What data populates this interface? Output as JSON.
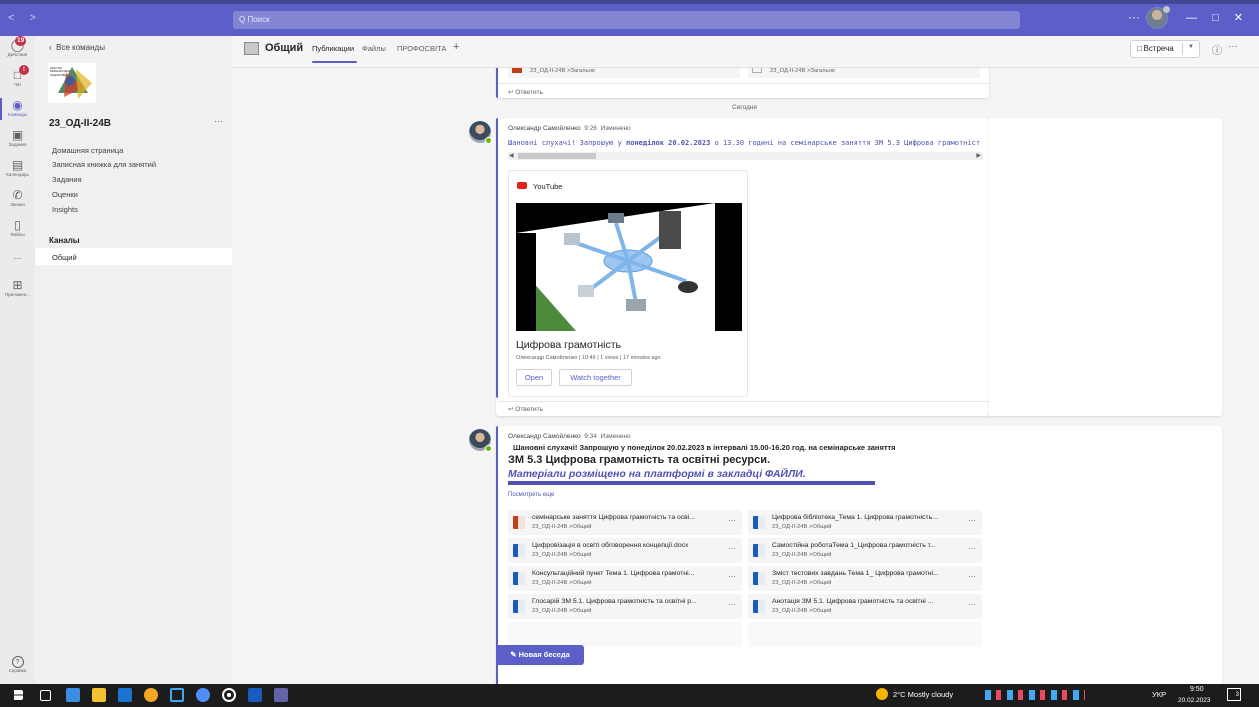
{
  "titlebar": {
    "nav": "< >",
    "search_placeholder": "Q Поиск",
    "more": "···",
    "window_controls": "— □ ✕"
  },
  "rail": {
    "items": [
      {
        "label": "Действия",
        "icon": "bell-icon",
        "glyph": "🔔",
        "badge": "19"
      },
      {
        "label": "Чат",
        "icon": "chat-icon",
        "glyph": "💬",
        "badge": "!"
      },
      {
        "label": "Команды",
        "icon": "teams-icon",
        "glyph": "👥",
        "active": true
      },
      {
        "label": "Задания",
        "icon": "assignments-icon",
        "glyph": "🎒"
      },
      {
        "label": "Календарь",
        "icon": "calendar-icon",
        "glyph": "📅"
      },
      {
        "label": "Звонки",
        "icon": "phone-icon",
        "glyph": "✆"
      },
      {
        "label": "Файлы",
        "icon": "file-icon",
        "glyph": "🗋"
      },
      {
        "label": "...",
        "icon": "more-icon",
        "glyph": ""
      },
      {
        "label": "Приложен...",
        "icon": "apps-icon",
        "glyph": "⊞"
      }
    ],
    "help_label": "Справка",
    "help_glyph": "?"
  },
  "left": {
    "back_label": "Все команды",
    "logo_text": "2023 XIII МІЖНАРОДНА ІНІЦІАТИВА",
    "team_name": "23_ОД-ІІ-24В",
    "more": "···",
    "links": [
      "Домашняя страница",
      "Записная книжка для занятий",
      "Задания",
      "Оценки",
      "Insights"
    ],
    "channels_header": "Каналы",
    "channel": "Общий"
  },
  "header": {
    "channel_title": "Общий",
    "tabs": [
      "Публикации",
      "Файлы",
      "ПРОФОСВІТА"
    ],
    "add_tab": "+",
    "meet_label": "Встреча",
    "meet_icon": "video-icon",
    "info": "ⓘ",
    "more": "···"
  },
  "conv": {
    "top_files": [
      {
        "path": "23_ОД-ІІ-24В >Загальне"
      },
      {
        "path": "23_ОД-ІІ-24В >Загальне"
      }
    ],
    "reply_label": "Ответить",
    "date_sep": "Сегодня",
    "msg1": {
      "author": "Олександр Самойленко",
      "time": "9:26",
      "edited": "Изменено",
      "text_plain": "Шановні слухачі! Запрошую у ",
      "text_bold": "понеділок 20.02.2023",
      "text_rest": " о 13.30 годині на семінарське заняття ЗМ 5.3 Цифрова грамотніст",
      "yt_label": "YouTube",
      "video_title": "Цифрова грамотність",
      "video_meta": "Олександр Самойленко | 10:46 | 1 views | 17 minutes ago",
      "btn_open": "Open",
      "btn_watch": "Watch together"
    },
    "msg2": {
      "author": "Олександр Самойленко",
      "time": "9:34",
      "edited": "Изменено",
      "line1": "Шановні слухачі! Запрошую у понеділок 20.02.2023 в інтервалі 15.00-16.20 год. на семінарське заняття",
      "line2": "ЗМ 5.3 Цифрова грамотність та освітні ресурси.",
      "line3": "Матеріали розміщено на платформі в закладці ФАЙЛИ.",
      "see_more": "Посмотреть еще",
      "files": [
        {
          "name": "семінарське заняття Цифрова грамотність та осві...",
          "path": "23_ОД-ІІ-24В >Общий",
          "type": "ppt"
        },
        {
          "name": "Цифрова бібліотека_Тема 1. Цифрова грамотність...",
          "path": "23_ОД-ІІ-24В >Общий",
          "type": "word"
        },
        {
          "name": "Цифровізація в освіті обговорення концепції.docx",
          "path": "23_ОД-ІІ-24В >Общий",
          "type": "word"
        },
        {
          "name": "Самостійна роботаТема 1_Цифрова грамотність т...",
          "path": "23_ОД-ІІ-24В >Общий",
          "type": "word"
        },
        {
          "name": "Консультаційний пункт Тема 1. Цифрова грамотні...",
          "path": "23_ОД-ІІ-24В >Общий",
          "type": "word"
        },
        {
          "name": "Зміст тестових завдань Тема 1_ Цифрова грамотні...",
          "path": "23_ОД-ІІ-24В >Общий",
          "type": "word"
        },
        {
          "name": "Глосарій ЗМ 5.1. Цифрова грамотність та освітні р...",
          "path": "23_ОД-ІІ-24В >Общий",
          "type": "word"
        },
        {
          "name": "Анотація ЗМ 5.1. Цифрова грамотність та освітні ...",
          "path": "23_ОД-ІІ-24В >Общий",
          "type": "word"
        }
      ],
      "file_more": "···"
    },
    "new_conversation": "Новая беседа"
  },
  "taskbar": {
    "weather": "2°C  Mostly cloudy",
    "lang": "УКР",
    "time": "9:50",
    "date": "20.02.2023",
    "notif": "3"
  },
  "colors": {
    "brand": "#5b5fc7",
    "titlebar": "#5b5fc7",
    "badge": "#c4314b",
    "presence": "#6bb700"
  }
}
